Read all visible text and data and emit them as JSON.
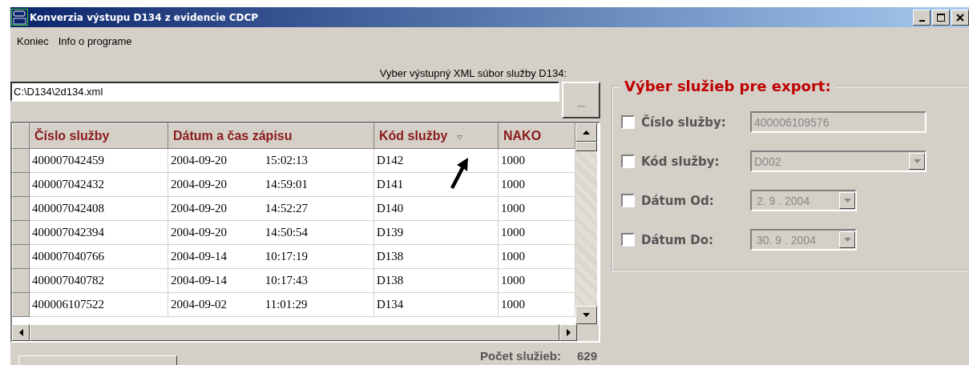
{
  "window": {
    "title": "Konverzia výstupu D134 z evidencie CDCP"
  },
  "menu": [
    "Koniec",
    "Info o programe"
  ],
  "file": {
    "label": "Vyber výstupný XML súbor služby D134:",
    "value": "C:\\D134\\2d134.xml",
    "browse_button": "..."
  },
  "table": {
    "columns": [
      {
        "label": "Číslo služby",
        "sorted": false
      },
      {
        "label": "Dátum a čas zápisu",
        "sorted": false
      },
      {
        "label": "Kód služby",
        "sorted": true
      },
      {
        "label": "NAKO",
        "sorted": false
      }
    ],
    "rows": [
      [
        "400007042459",
        "2004-09-20 15:02:13",
        "D142",
        "1000"
      ],
      [
        "400007042432",
        "2004-09-20 14:59:01",
        "D141",
        "1000"
      ],
      [
        "400007042408",
        "2004-09-20 14:52:27",
        "D140",
        "1000"
      ],
      [
        "400007042394",
        "2004-09-20 14:50:54",
        "D139",
        "1000"
      ],
      [
        "400007040766",
        "2004-09-14 10:17:19",
        "D138",
        "1000"
      ],
      [
        "400007040782",
        "2004-09-14 10:17:43",
        "D138",
        "1000"
      ],
      [
        "400006107522",
        "2004-09-02 11:01:29",
        "D134",
        "1000"
      ]
    ]
  },
  "filter": {
    "title": "Výber služieb pre export:",
    "items": [
      {
        "kind": "text",
        "label": "Číslo služby:",
        "value": "400006109576",
        "checked": false,
        "disabled": true
      },
      {
        "kind": "combo",
        "label": "Kód služby:",
        "value": "D002",
        "checked": false,
        "disabled": true
      },
      {
        "kind": "date",
        "label": "Dátum Od:",
        "value": "2. 9 . 2004",
        "checked": false,
        "disabled": true
      },
      {
        "kind": "date",
        "label": "Dátum Do:",
        "value": "30. 9 . 2004",
        "checked": false,
        "disabled": true
      }
    ]
  },
  "footer": {
    "count_label": "Počet služieb:",
    "count_value": "629"
  }
}
